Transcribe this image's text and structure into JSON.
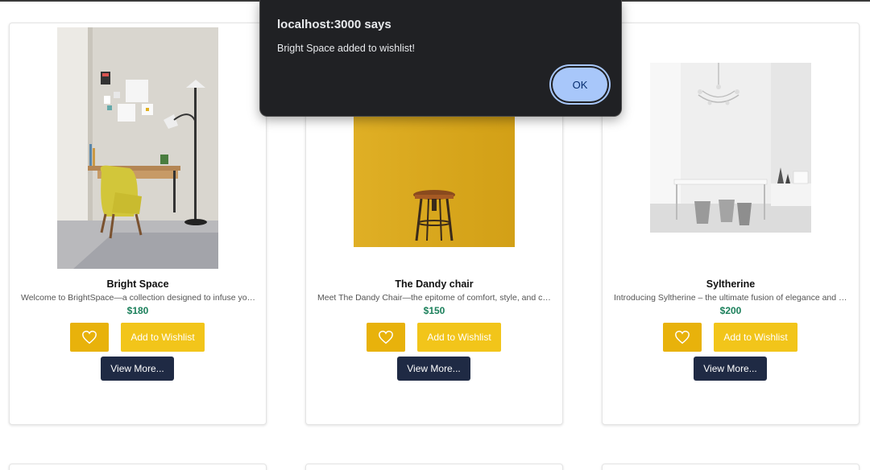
{
  "dialog": {
    "title": "localhost:3000 says",
    "message": "Bright Space added to wishlist!",
    "ok_label": "OK"
  },
  "products": [
    {
      "name": "Bright Space",
      "description": "Welcome to BrightSpace—a collection designed to infuse your space with light",
      "price": "$180",
      "wishlist_label": "Add to Wishlist",
      "more_label": "View More..."
    },
    {
      "name": "The Dandy chair",
      "description": "Meet The Dandy Chair—the epitome of comfort, style, and charm",
      "price": "$150",
      "wishlist_label": "Add to Wishlist",
      "more_label": "View More..."
    },
    {
      "name": "Syltherine",
      "description": "Introducing Syltherine – the ultimate fusion of elegance and powerful design",
      "price": "$200",
      "wishlist_label": "Add to Wishlist",
      "more_label": "View More..."
    }
  ],
  "icons": {
    "heart": "heart-icon"
  },
  "colors": {
    "price": "#1a7f5a",
    "heart_button": "#e8b20b",
    "wishlist_button": "#f2c51a",
    "more_button": "#1f2a44",
    "dialog_bg": "#202124",
    "ok_button": "#a8c7fa"
  }
}
